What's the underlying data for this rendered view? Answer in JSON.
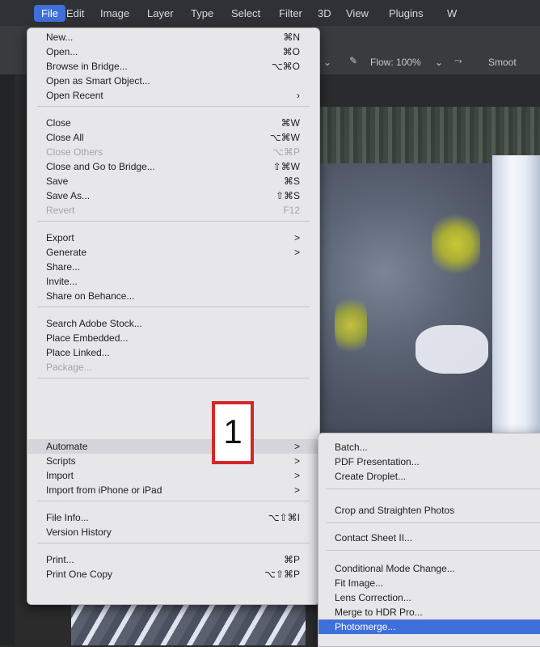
{
  "menubar": {
    "items": [
      {
        "label": "File",
        "active": true
      },
      {
        "label": "Edit"
      },
      {
        "label": "Image"
      },
      {
        "label": "Layer"
      },
      {
        "label": "Type"
      },
      {
        "label": "Select"
      },
      {
        "label": "Filter"
      },
      {
        "label": "3D"
      },
      {
        "label": "View"
      },
      {
        "label": "Plugins"
      },
      {
        "label": "W"
      }
    ]
  },
  "options_bar": {
    "flow_label": "Flow: 100%",
    "smoothing_label": "Smoot"
  },
  "file_menu": {
    "items": [
      {
        "label": "New...",
        "shortcut": "⌘N"
      },
      {
        "label": "Open...",
        "shortcut": "⌘O"
      },
      {
        "label": "Browse in Bridge...",
        "shortcut": "⌥⌘O"
      },
      {
        "label": "Open as Smart Object..."
      },
      {
        "label": "Open Recent",
        "arrow": "›"
      },
      {
        "label": "Close",
        "shortcut": "⌘W"
      },
      {
        "label": "Close All",
        "shortcut": "⌥⌘W"
      },
      {
        "label": "Close Others",
        "shortcut": "⌥⌘P",
        "disabled": true
      },
      {
        "label": "Close and Go to Bridge...",
        "shortcut": "⇧⌘W"
      },
      {
        "label": "Save",
        "shortcut": "⌘S"
      },
      {
        "label": "Save As...",
        "shortcut": "⇧⌘S"
      },
      {
        "label": "Revert",
        "shortcut": "F12",
        "disabled": true
      },
      {
        "label": "Export",
        "arrow": ">"
      },
      {
        "label": "Generate",
        "arrow": ">"
      },
      {
        "label": "Share..."
      },
      {
        "label": "Invite..."
      },
      {
        "label": "Share on Behance..."
      },
      {
        "label": "Search Adobe Stock..."
      },
      {
        "label": "Place Embedded..."
      },
      {
        "label": "Place Linked..."
      },
      {
        "label": "Package...",
        "disabled": true
      },
      {
        "label": "Automate",
        "arrow": ">",
        "highlight": true
      },
      {
        "label": "Scripts",
        "arrow": ">"
      },
      {
        "label": "Import",
        "arrow": ">"
      },
      {
        "label": "Import from iPhone or iPad",
        "arrow": ">"
      },
      {
        "label": "File Info...",
        "shortcut": "⌥⇧⌘I"
      },
      {
        "label": "Version History"
      },
      {
        "label": "Print...",
        "shortcut": "⌘P"
      },
      {
        "label": "Print One Copy",
        "shortcut": "⌥⇧⌘P"
      }
    ]
  },
  "automate_submenu": {
    "items": [
      {
        "label": "Batch..."
      },
      {
        "label": "PDF Presentation..."
      },
      {
        "label": "Create Droplet..."
      },
      {
        "label": "Crop and Straighten Photos"
      },
      {
        "label": "Contact Sheet II..."
      },
      {
        "label": "Conditional Mode Change..."
      },
      {
        "label": "Fit Image..."
      },
      {
        "label": "Lens Correction..."
      },
      {
        "label": "Merge to HDR Pro..."
      },
      {
        "label": "Photomerge...",
        "selected": true
      }
    ]
  },
  "callout": {
    "number": "1"
  },
  "colors": {
    "accent": "#3f6fd9",
    "callout_border": "#d5262b",
    "menu_bg": "#e7e7e9"
  }
}
